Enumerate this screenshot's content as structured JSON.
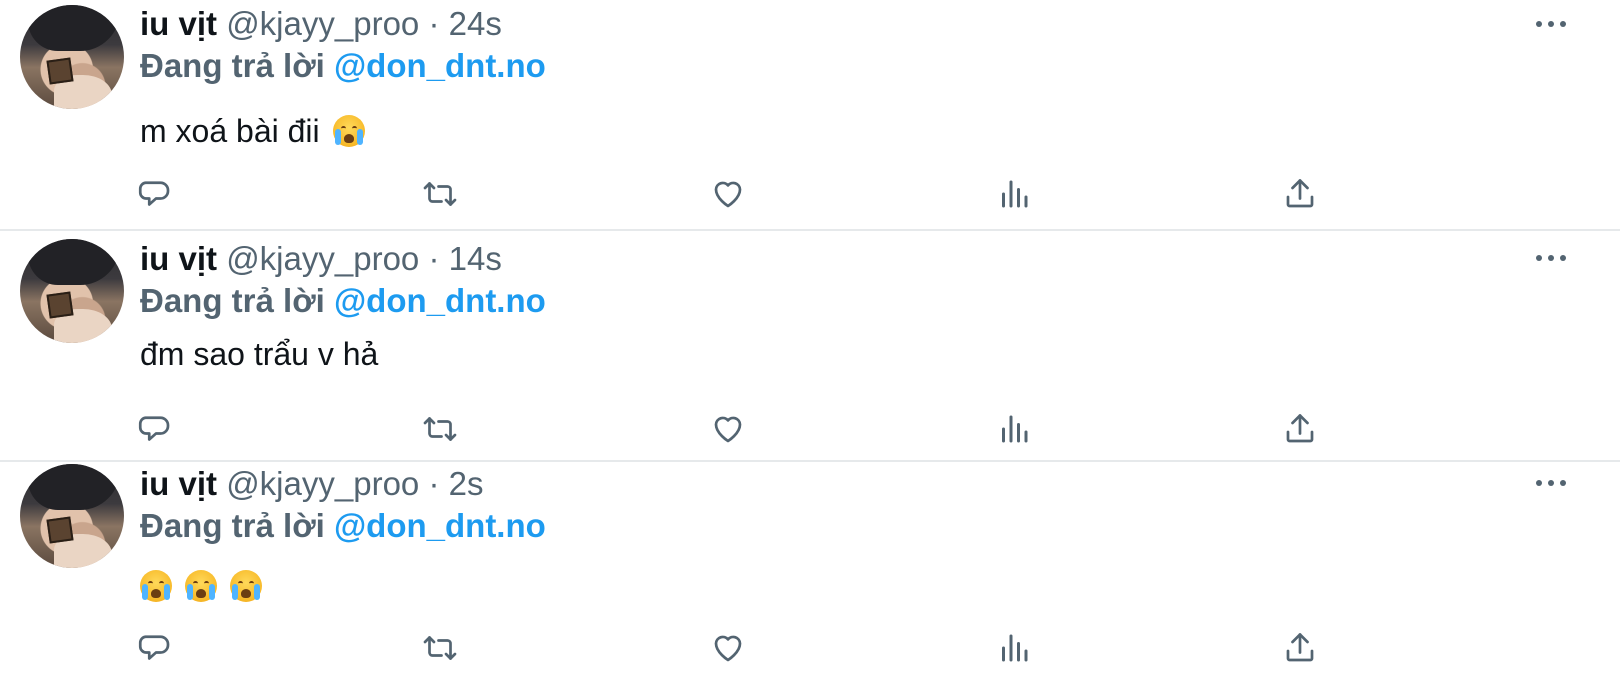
{
  "colors": {
    "text": "#0f1419",
    "secondary": "#536471",
    "mention": "#1d9bf0",
    "divider": "#e6e9eb",
    "background": "#ffffff"
  },
  "tweets": [
    {
      "name": "iu vịt",
      "handle": "@kjayy_proo",
      "separator": "·",
      "time": "24s",
      "reply_prefix": "Đang trả lời",
      "reply_to": "@don_dnt.no",
      "text": "m xoá bài đii",
      "emojis": [
        "loudly-crying-face"
      ]
    },
    {
      "name": "iu vịt",
      "handle": "@kjayy_proo",
      "separator": "·",
      "time": "14s",
      "reply_prefix": "Đang trả lời",
      "reply_to": "@don_dnt.no",
      "text": "đm sao trẩu v hả",
      "emojis": []
    },
    {
      "name": "iu vịt",
      "handle": "@kjayy_proo",
      "separator": "·",
      "time": "2s",
      "reply_prefix": "Đang trả lời",
      "reply_to": "@don_dnt.no",
      "text": "",
      "emojis": [
        "loudly-crying-face",
        "loudly-crying-face",
        "loudly-crying-face"
      ]
    }
  ],
  "icons": {
    "more": "more-horizontal-icon",
    "reply": "reply-bubble-icon",
    "retweet": "retweet-icon",
    "like": "heart-icon",
    "views": "views-bar-chart-icon",
    "share": "share-upload-icon"
  }
}
